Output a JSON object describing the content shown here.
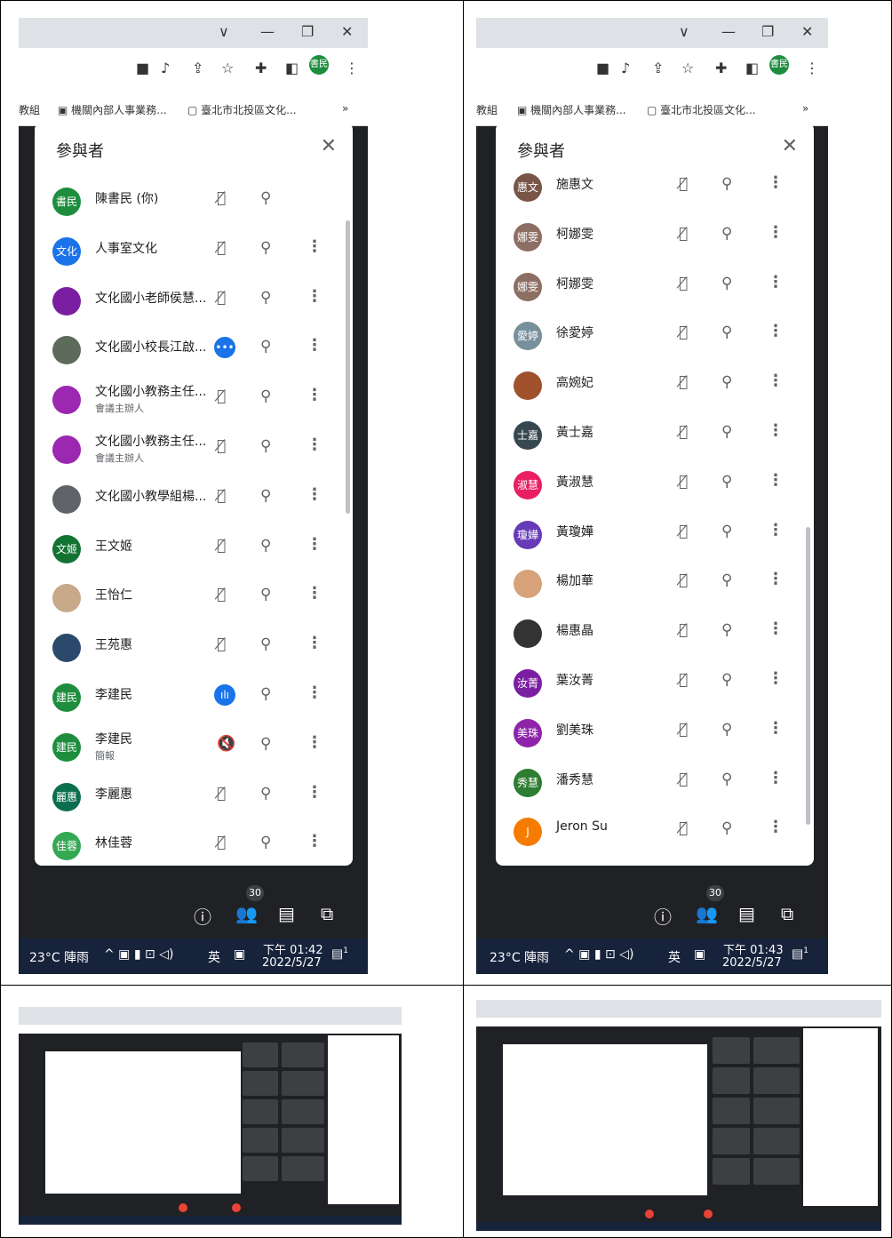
{
  "browser": {
    "controls": [
      "∨",
      "—",
      "❐",
      "✕"
    ],
    "profile_badge": "書民",
    "bookmarks_left": [
      "教組",
      "機關內部人事業務...",
      "臺北市北投區文化..."
    ],
    "bookmarks_right": [
      "教組",
      "機關內部人事業務...",
      "臺北市北投區文化..."
    ],
    "more_bookmarks": "»"
  },
  "panel_left": {
    "title": "參與者",
    "rows": [
      {
        "avatar": "書民",
        "color": "#1e8e3e",
        "name": "陳書民 (你)",
        "sub": "",
        "mic": "muted",
        "more": false
      },
      {
        "avatar": "文化",
        "color": "#1a73e8",
        "name": "人事室文化",
        "sub": "",
        "mic": "muted",
        "more": true
      },
      {
        "avatar": "",
        "color": "#7b1fa2",
        "name": "文化國小老師侯慧...",
        "sub": "",
        "mic": "muted",
        "more": true
      },
      {
        "avatar": "",
        "color": "#5d6b5a",
        "name": "文化國小校長江啟...",
        "sub": "",
        "mic": "bubble",
        "more": true
      },
      {
        "avatar": "",
        "color": "#9c27b0",
        "name": "文化國小教務主任...",
        "sub": "會議主辦人",
        "mic": "muted",
        "more": true
      },
      {
        "avatar": "",
        "color": "#9c27b0",
        "name": "文化國小教務主任...",
        "sub": "會議主辦人",
        "mic": "muted",
        "more": true
      },
      {
        "avatar": "",
        "color": "#5f6368",
        "name": "文化國小教學組楊...",
        "sub": "",
        "mic": "muted",
        "more": true
      },
      {
        "avatar": "文姬",
        "color": "#137333",
        "name": "王文姬",
        "sub": "",
        "mic": "muted",
        "more": true
      },
      {
        "avatar": "",
        "color": "#c8a98a",
        "name": "王怡仁",
        "sub": "",
        "mic": "muted",
        "more": true
      },
      {
        "avatar": "",
        "color": "#2b4a6b",
        "name": "王苑惠",
        "sub": "",
        "mic": "muted",
        "more": true
      },
      {
        "avatar": "建民",
        "color": "#1e8e3e",
        "name": "李建民",
        "sub": "",
        "mic": "speaking",
        "more": true
      },
      {
        "avatar": "建民",
        "color": "#1e8e3e",
        "name": "李建民",
        "sub": "簡報",
        "mic": "speaker-off",
        "more": true
      },
      {
        "avatar": "麗惠",
        "color": "#0b6e4f",
        "name": "李麗惠",
        "sub": "",
        "mic": "muted",
        "more": true
      },
      {
        "avatar": "佳蓉",
        "color": "#34a853",
        "name": "林佳蓉",
        "sub": "",
        "mic": "muted",
        "more": true
      }
    ]
  },
  "panel_right": {
    "title": "參與者",
    "rows": [
      {
        "avatar": "惠文",
        "color": "#795548",
        "name": "施惠文"
      },
      {
        "avatar": "娜雯",
        "color": "#8d6e63",
        "name": "柯娜雯"
      },
      {
        "avatar": "娜雯",
        "color": "#8d6e63",
        "name": "柯娜雯"
      },
      {
        "avatar": "愛婷",
        "color": "#78909c",
        "name": "徐愛婷"
      },
      {
        "avatar": "",
        "color": "#a0522d",
        "name": "高婉妃"
      },
      {
        "avatar": "士嘉",
        "color": "#37474f",
        "name": "黃士嘉"
      },
      {
        "avatar": "淑慧",
        "color": "#e91e63",
        "name": "黃淑慧"
      },
      {
        "avatar": "瓊嬅",
        "color": "#673ab7",
        "name": "黃瓊嬅"
      },
      {
        "avatar": "",
        "color": "#d7a27a",
        "name": "楊加華"
      },
      {
        "avatar": "",
        "color": "#333333",
        "name": "楊惠晶"
      },
      {
        "avatar": "汝菁",
        "color": "#7b1fa2",
        "name": "葉汝菁"
      },
      {
        "avatar": "美珠",
        "color": "#8e24aa",
        "name": "劉美珠"
      },
      {
        "avatar": "秀慧",
        "color": "#2e7d32",
        "name": "潘秀慧"
      },
      {
        "avatar": "J",
        "color": "#f57c00",
        "name": "Jeron Su"
      }
    ]
  },
  "meet_bar": {
    "count": "30"
  },
  "taskbar_left": {
    "weather": "23°C 陣雨",
    "ime": "英",
    "time": "下午 01:42",
    "date": "2022/5/27",
    "notif": "1"
  },
  "taskbar_right": {
    "weather": "23°C 陣雨",
    "ime": "英",
    "time": "下午 01:43",
    "date": "2022/5/27",
    "notif": "1"
  }
}
